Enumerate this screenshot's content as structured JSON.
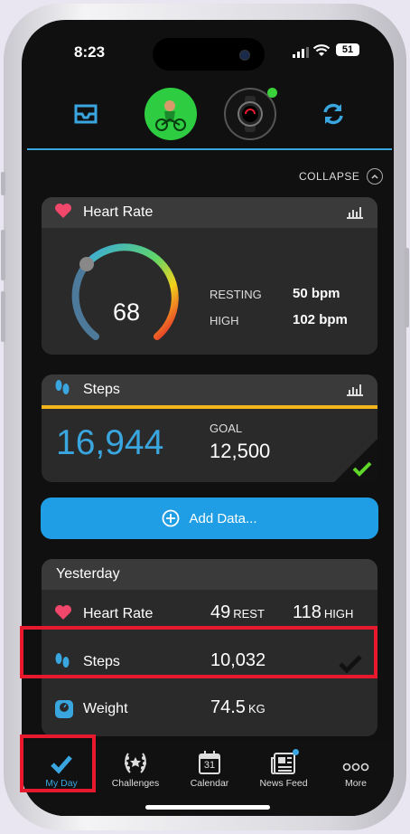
{
  "status": {
    "time": "8:23",
    "battery": "51"
  },
  "collapse_label": "COLLAPSE",
  "heart_rate": {
    "title": "Heart Rate",
    "value": "68",
    "resting_label": "RESTING",
    "resting_value": "50 bpm",
    "high_label": "HIGH",
    "high_value": "102 bpm"
  },
  "steps": {
    "title": "Steps",
    "value": "16,944",
    "goal_label": "GOAL",
    "goal_value": "12,500"
  },
  "add_data_label": "Add Data...",
  "yesterday": {
    "title": "Yesterday",
    "heart_rate": {
      "label": "Heart Rate",
      "rest_value": "49",
      "rest_unit": "REST",
      "high_value": "118",
      "high_unit": "HIGH"
    },
    "steps": {
      "label": "Steps",
      "value": "10,032"
    },
    "weight": {
      "label": "Weight",
      "value": "74.5",
      "unit": "KG"
    }
  },
  "tabs": [
    {
      "label": "My Day"
    },
    {
      "label": "Challenges"
    },
    {
      "label": "Calendar",
      "day": "31"
    },
    {
      "label": "News Feed"
    },
    {
      "label": "More"
    }
  ],
  "colors": {
    "accent": "#3aa6df",
    "heart": "#f0476b",
    "goal_bar": "#f2b51b",
    "add_button": "#1f9ee6",
    "highlight": "#e8192c"
  },
  "icons": [
    "inbox-icon",
    "avatar-icon",
    "watch-icon",
    "sync-icon",
    "heart-icon",
    "footprints-icon",
    "scale-icon",
    "checkmark-icon",
    "chart-icon",
    "plus-circle-icon",
    "laurel-icon",
    "calendar-icon",
    "news-icon",
    "more-icon"
  ]
}
